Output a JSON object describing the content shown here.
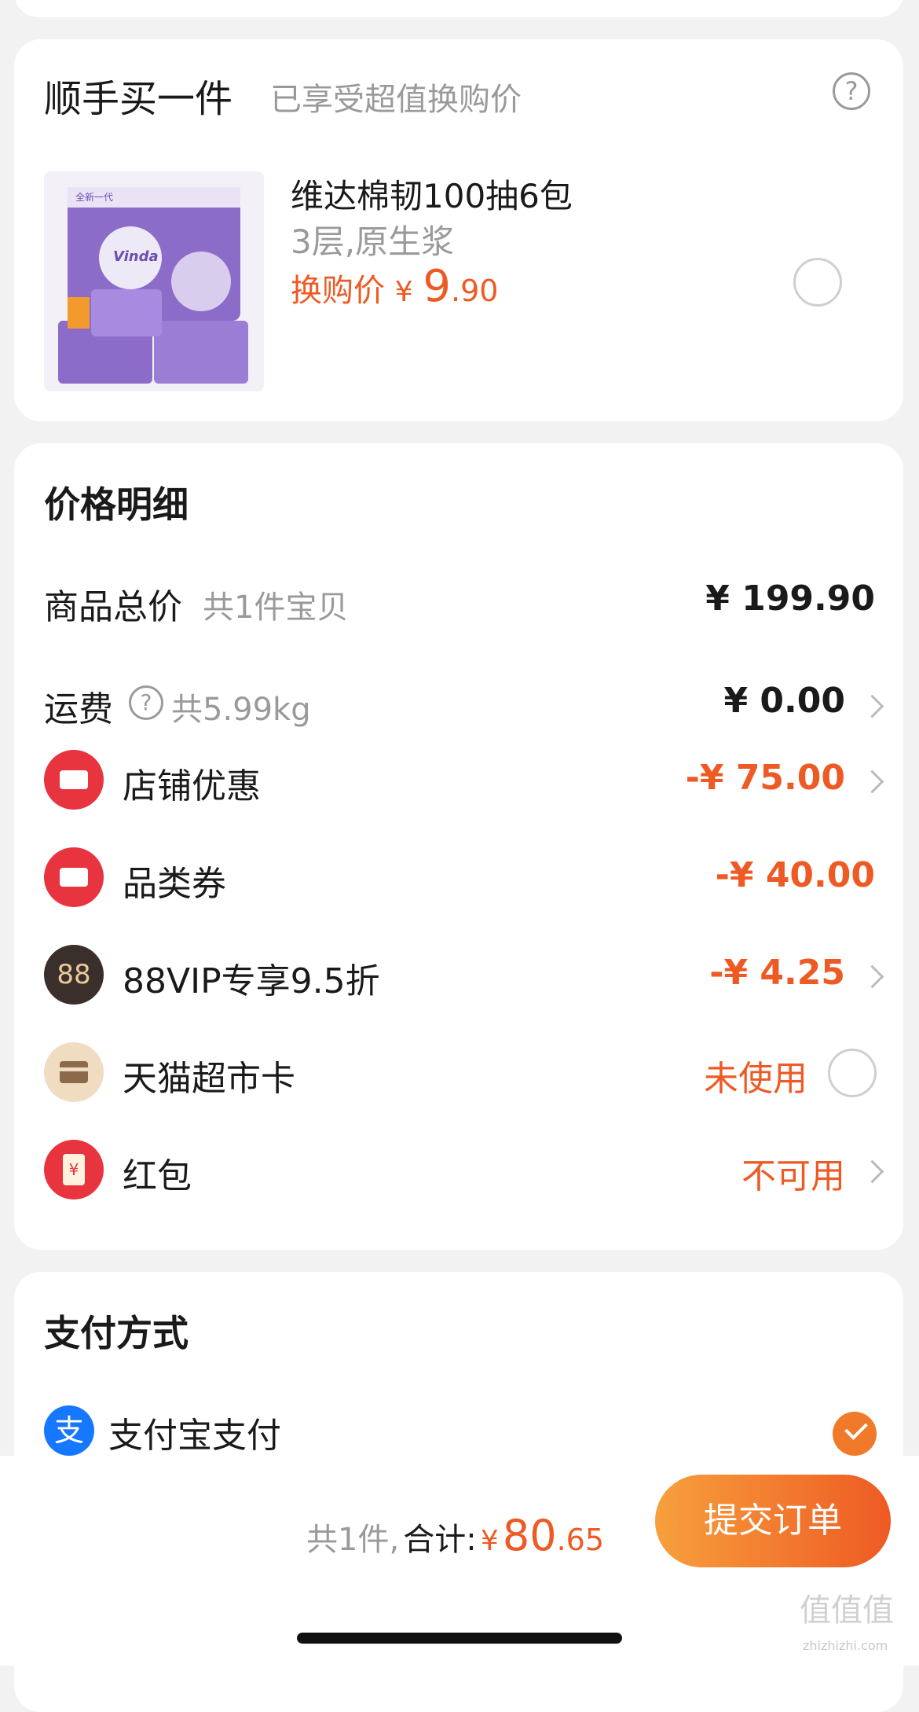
{
  "addon": {
    "title": "顺手买一件",
    "subtitle": "已享受超值换购价",
    "product": {
      "name": "维达棉韧100抽6包",
      "spec": "3层,原生浆",
      "price_label": "换购价",
      "currency": "¥",
      "price_int": "9",
      "price_dec": ".90",
      "package_brand": "Vinda",
      "package_tag": "全新一代"
    }
  },
  "price_detail": {
    "title": "价格明细",
    "rows": [
      {
        "label": "商品总价",
        "note": "共1件宝贝",
        "amount": "¥ 199.90"
      },
      {
        "label": "运费",
        "note": "共5.99kg",
        "amount": "¥ 0.00"
      },
      {
        "label": "店铺优惠",
        "amount": "-¥ 75.00"
      },
      {
        "label": "品类券",
        "amount": "-¥ 40.00"
      },
      {
        "label": "88VIP专享9.5折",
        "icon_text": "88",
        "amount": "-¥ 4.25"
      },
      {
        "label": "天猫超市卡",
        "amount": "未使用"
      },
      {
        "label": "红包",
        "icon_text": "¥",
        "amount": "不可用"
      }
    ]
  },
  "payment": {
    "title": "支付方式",
    "method": "支付宝支付",
    "method_icon_text": "支"
  },
  "footer": {
    "count_text": "共1件,",
    "total_label": "合计:",
    "currency": "¥",
    "total_int": "80",
    "total_dec": ".65",
    "submit": "提交订单"
  },
  "watermark": {
    "main": "值值值",
    "sub": "zhizhizhi.com"
  },
  "colors": {
    "accent": "#ee5a24",
    "coupon_red": "#e8343e",
    "vip_dark": "#3a2f2a",
    "card_gold": "#f0dcc0"
  }
}
